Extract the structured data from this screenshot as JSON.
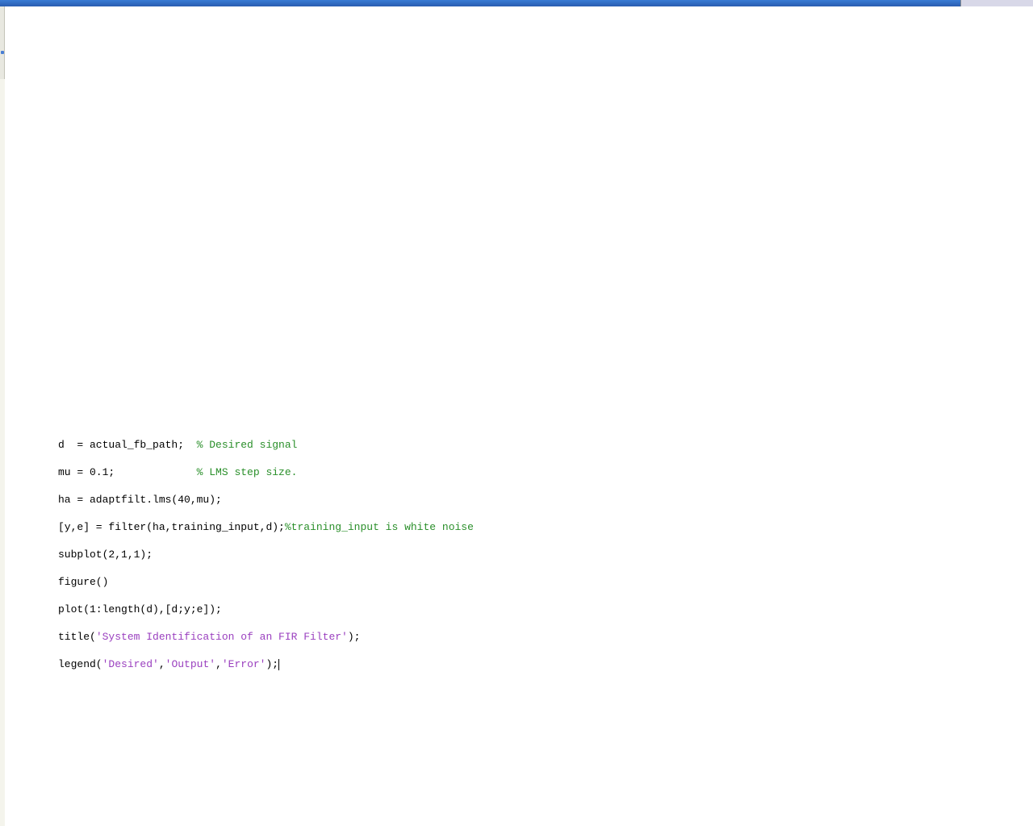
{
  "code": {
    "lines": [
      {
        "code": "d  = actual_fb_path;  ",
        "comment": "% Desired signal"
      },
      {
        "code": "mu = 0.1;             ",
        "comment": "% LMS step size."
      },
      {
        "code": "ha = adaptfilt.lms(40,mu);",
        "comment": ""
      },
      {
        "code": "[y,e] = filter(ha,training_input,d);",
        "comment": "%training_input is white noise"
      },
      {
        "code": "subplot(2,1,1);",
        "comment": ""
      },
      {
        "code": "figure()",
        "comment": ""
      },
      {
        "code": "plot(1:length(d),[d;y;e]);",
        "comment": ""
      },
      {
        "code_pre": "title(",
        "string": "'System Identification of an FIR Filter'",
        "code_post": ");"
      },
      {
        "code_pre": "legend(",
        "string1": "'Desired'",
        "sep1": ",",
        "string2": "'Output'",
        "sep2": ",",
        "string3": "'Error'",
        "code_post": ");"
      }
    ]
  }
}
